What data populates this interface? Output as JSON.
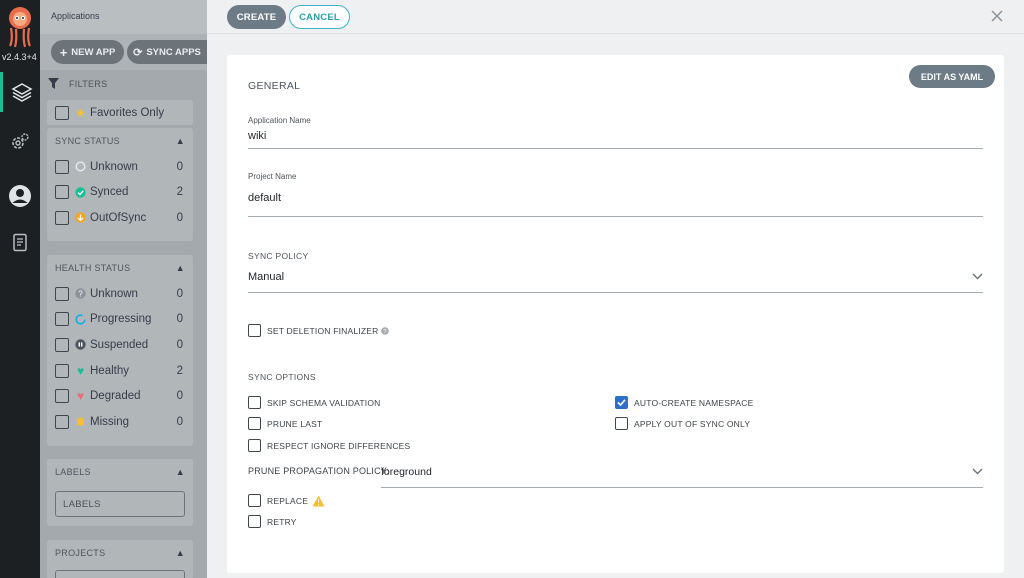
{
  "nav": {
    "version": "v2.4.3+4",
    "items": [
      "applications-icon",
      "settings-icon",
      "user-icon",
      "docs-icon"
    ]
  },
  "background": {
    "page_title": "Applications",
    "toolbar": {
      "new_app": "NEW APP",
      "sync_apps": "SYNC APPS"
    },
    "filters_label": "FILTERS",
    "favorites": "Favorites Only",
    "sync_status": {
      "title": "SYNC STATUS",
      "items": [
        {
          "label": "Unknown",
          "count": "0"
        },
        {
          "label": "Synced",
          "count": "2"
        },
        {
          "label": "OutOfSync",
          "count": "0"
        }
      ]
    },
    "health_status": {
      "title": "HEALTH STATUS",
      "items": [
        {
          "label": "Unknown",
          "count": "0"
        },
        {
          "label": "Progressing",
          "count": "0"
        },
        {
          "label": "Suspended",
          "count": "0"
        },
        {
          "label": "Healthy",
          "count": "2"
        },
        {
          "label": "Degraded",
          "count": "0"
        },
        {
          "label": "Missing",
          "count": "0"
        }
      ]
    },
    "labels": {
      "title": "LABELS",
      "placeholder": "LABELS"
    },
    "projects": {
      "title": "PROJECTS"
    }
  },
  "panel": {
    "create": "CREATE",
    "cancel": "CANCEL",
    "edit_yaml": "EDIT AS YAML",
    "general": "GENERAL",
    "app_name_label": "Application Name",
    "app_name_value": "wiki",
    "project_label": "Project Name",
    "project_value": "default",
    "sync_policy_title": "SYNC POLICY",
    "sync_policy_value": "Manual",
    "finalizer": {
      "label": "SET DELETION FINALIZER",
      "checked": false
    },
    "sync_options_title": "SYNC OPTIONS",
    "options_left": [
      {
        "label": "SKIP SCHEMA VALIDATION",
        "checked": false
      },
      {
        "label": "PRUNE LAST",
        "checked": false
      },
      {
        "label": "RESPECT IGNORE DIFFERENCES",
        "checked": false
      }
    ],
    "options_right": [
      {
        "label": "AUTO-CREATE NAMESPACE",
        "checked": true
      },
      {
        "label": "APPLY OUT OF SYNC ONLY",
        "checked": false
      }
    ],
    "prune_policy_label": "PRUNE PROPAGATION POLICY:",
    "prune_policy_value": "foreground",
    "replace": {
      "label": "REPLACE",
      "checked": false
    },
    "retry": {
      "label": "RETRY",
      "checked": false
    }
  },
  "colors": {
    "accent": "#2e6fca",
    "primary_button": "#6d7b87",
    "cancel_text": "#2b9fb1",
    "synced": "#18be94",
    "out_of_sync": "#f4c030",
    "healthy": "#18be94",
    "degraded": "#e96d76",
    "progressing": "#0dadea",
    "warning": "#f4c030"
  }
}
